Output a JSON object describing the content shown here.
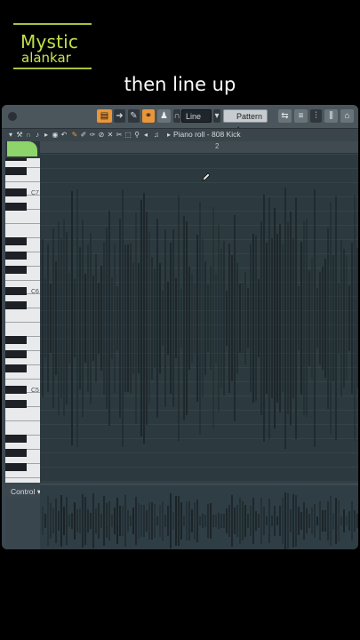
{
  "branding": {
    "line1": "Mystic",
    "line2": "alankar"
  },
  "caption": "then line up",
  "toolbar": {
    "snap_mode": "Line",
    "pattern": "Pattern 1"
  },
  "piano_roll": {
    "title": "Piano roll - 808 Kick",
    "ruler_number": "2",
    "key_labels": [
      "C7",
      "C6",
      "C5"
    ]
  },
  "control": {
    "label": "Control"
  },
  "colors": {
    "accent": "#e9963a",
    "brand": "#bfe04a",
    "corner": "#8dd46a"
  }
}
